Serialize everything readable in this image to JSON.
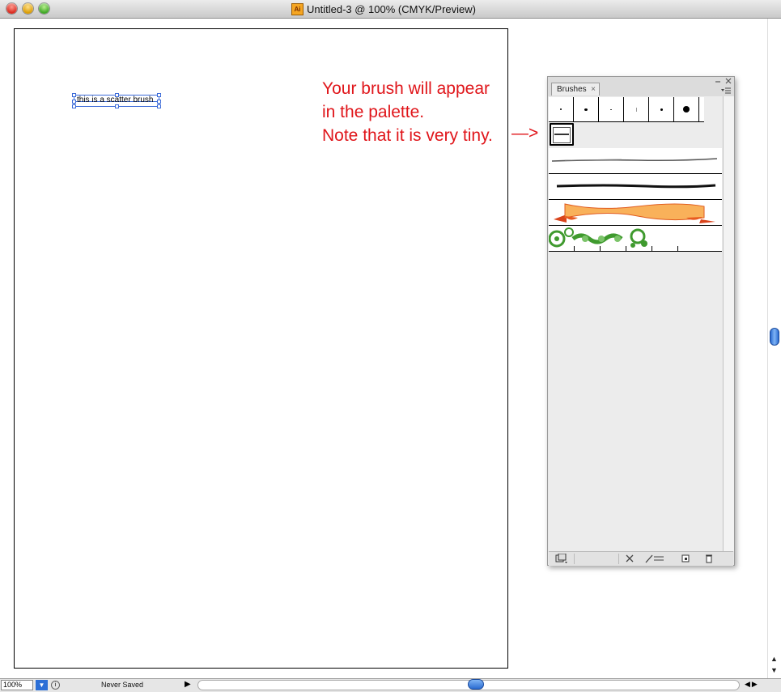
{
  "window": {
    "title": "Untitled-3 @ 100% (CMYK/Preview)",
    "app_icon_label": "Ai"
  },
  "canvas": {
    "selected_text": "this is a scatter brush"
  },
  "annotation": {
    "lines": [
      "Your brush will appear",
      "in the palette.",
      "Note that it is very tiny."
    ],
    "arrow": "—>",
    "color": "#e0151a"
  },
  "brushes_panel": {
    "tab_label": "Brushes",
    "tab_close": "×",
    "collapse_icon": "chevron-icon",
    "close_icon": "close-icon",
    "menu_icon": "panel-menu-icon",
    "calligraphic_brushes": 6,
    "art_brushes": [
      "charcoal-thin",
      "charcoal-thick",
      "ribbon-banner"
    ],
    "pattern_brush": "green-ornament-pattern",
    "footer_icons": [
      "brush-libraries-icon",
      "remove-stroke-icon",
      "brush-options-icon",
      "new-brush-icon",
      "delete-brush-icon"
    ]
  },
  "status_bar": {
    "zoom": "100%",
    "status": "Never Saved"
  }
}
